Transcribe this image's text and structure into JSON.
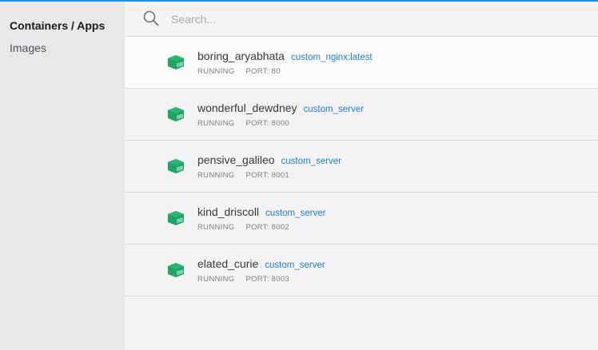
{
  "sidebar": {
    "items": [
      {
        "label": "Containers / Apps",
        "active": true
      },
      {
        "label": "Images",
        "active": false
      }
    ]
  },
  "search": {
    "placeholder": "Search..."
  },
  "containers": [
    {
      "name": "boring_aryabhata",
      "image": "custom_nginx:latest",
      "status": "RUNNING",
      "port": "PORT: 80"
    },
    {
      "name": "wonderful_dewdney",
      "image": "custom_server",
      "status": "RUNNING",
      "port": "PORT: 8000"
    },
    {
      "name": "pensive_galileo",
      "image": "custom_server",
      "status": "RUNNING",
      "port": "PORT: 8001"
    },
    {
      "name": "kind_driscoll",
      "image": "custom_server",
      "status": "RUNNING",
      "port": "PORT: 8002"
    },
    {
      "name": "elated_curie",
      "image": "custom_server",
      "status": "RUNNING",
      "port": "PORT: 8003"
    }
  ],
  "colors": {
    "accent": "#1d8fe6",
    "container_icon": "#1fa464",
    "image_link": "#1e7fcb"
  },
  "icons": {
    "search": "search-icon",
    "container": "container-icon"
  }
}
